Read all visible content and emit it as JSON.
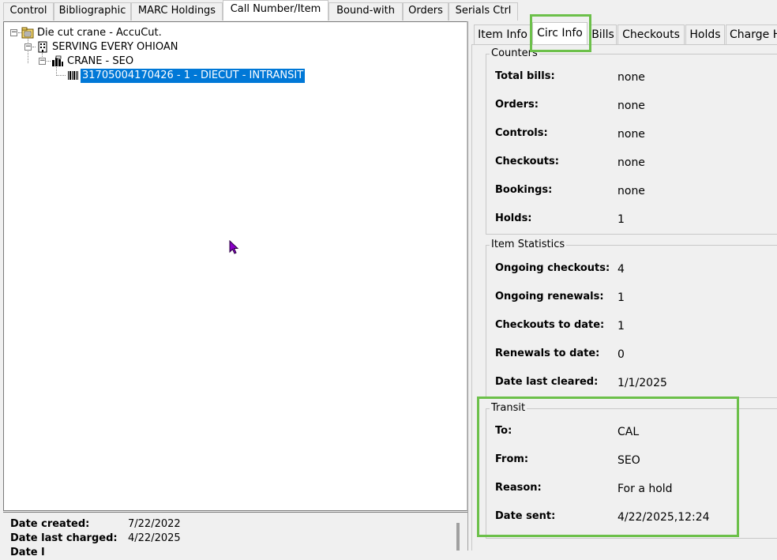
{
  "top_tabs": [
    {
      "label": "Control"
    },
    {
      "label": "Bibliographic"
    },
    {
      "label": "MARC Holdings"
    },
    {
      "label": "Call Number/Item"
    },
    {
      "label": "Bound-with"
    },
    {
      "label": "Orders"
    },
    {
      "label": "Serials Ctrl"
    }
  ],
  "active_top_tab": "Call Number/Item",
  "tree": {
    "title": "Die cut crane - AccuCut.",
    "library": "SERVING EVERY OHIOAN",
    "call_number": "CRANE - SEO",
    "item": "31705004170426 - 1 - DIECUT - INTRANSIT",
    "toggle_minus": "−"
  },
  "info": {
    "date_created_label": "Date created:",
    "date_created_value": "7/22/2022",
    "date_last_charged_label": "Date last charged:",
    "date_last_charged_value": "4/22/2025",
    "date_partial_label": "Date l"
  },
  "right_tabs": [
    {
      "label": "Item Info"
    },
    {
      "label": "Circ Info"
    },
    {
      "label": "Bills"
    },
    {
      "label": "Checkouts"
    },
    {
      "label": "Holds"
    },
    {
      "label": "Charge H"
    }
  ],
  "active_right_tab": "Circ Info",
  "counters": {
    "title": "Counters",
    "rows": [
      {
        "label": "Total bills:",
        "value": "none"
      },
      {
        "label": "Orders:",
        "value": "none"
      },
      {
        "label": "Controls:",
        "value": "none"
      },
      {
        "label": "Checkouts:",
        "value": "none"
      },
      {
        "label": "Bookings:",
        "value": "none"
      },
      {
        "label": "Holds:",
        "value": "1"
      }
    ]
  },
  "item_statistics": {
    "title": "Item Statistics",
    "rows": [
      {
        "label": "Ongoing checkouts:",
        "value": "4"
      },
      {
        "label": "Ongoing renewals:",
        "value": "1"
      },
      {
        "label": "Checkouts to date:",
        "value": "1"
      },
      {
        "label": "Renewals to date:",
        "value": "0"
      },
      {
        "label": "Date last cleared:",
        "value": "1/1/2025"
      }
    ]
  },
  "transit": {
    "title": "Transit",
    "rows": [
      {
        "label": "To:",
        "value": "CAL"
      },
      {
        "label": "From:",
        "value": "SEO"
      },
      {
        "label": "Reason:",
        "value": "For a hold"
      },
      {
        "label": "Date sent:",
        "value": "4/22/2025,12:24"
      }
    ]
  },
  "colors": {
    "highlight": "#6cc04a",
    "selection": "#0078d7",
    "cursor": "#8a00c8"
  }
}
